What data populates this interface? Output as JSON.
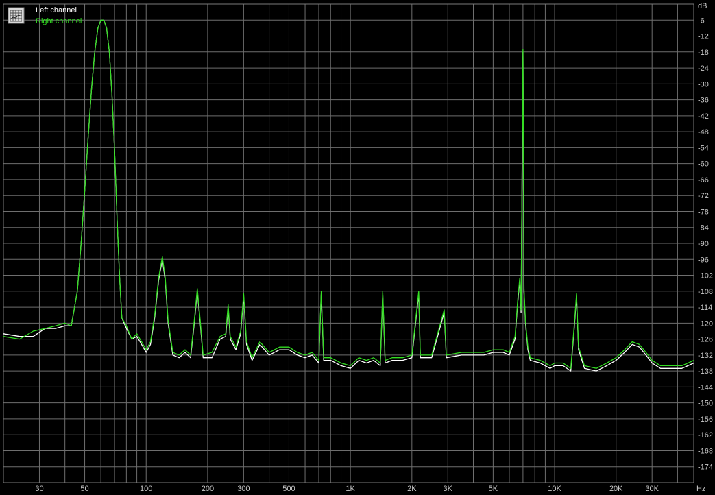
{
  "chart_data": {
    "type": "line",
    "x_scale": "log",
    "xlim": [
      20,
      48000
    ],
    "ylim": [
      -180,
      0
    ],
    "grid": true,
    "legend_position": "top-left",
    "y_unit": "dB",
    "x_unit": "Hz",
    "y_ticks": [
      -6,
      -12,
      -18,
      -24,
      -30,
      -36,
      -42,
      -48,
      -54,
      -60,
      -66,
      -72,
      -78,
      -84,
      -90,
      -96,
      -102,
      -108,
      -114,
      -120,
      -126,
      -132,
      -138,
      -144,
      -150,
      -156,
      -162,
      -168,
      -174
    ],
    "x_ticks": [
      {
        "value": 30,
        "label": "30"
      },
      {
        "value": 50,
        "label": "50"
      },
      {
        "value": 100,
        "label": "100"
      },
      {
        "value": 200,
        "label": "200"
      },
      {
        "value": 300,
        "label": "300"
      },
      {
        "value": 500,
        "label": "500"
      },
      {
        "value": 1000,
        "label": "1K"
      },
      {
        "value": 2000,
        "label": "2K"
      },
      {
        "value": 3000,
        "label": "3K"
      },
      {
        "value": 5000,
        "label": "5K"
      },
      {
        "value": 10000,
        "label": "10K"
      },
      {
        "value": 20000,
        "label": "20K"
      },
      {
        "value": 30000,
        "label": "30K"
      }
    ],
    "series": [
      {
        "name": "Left channel",
        "color": "#ffffff",
        "points": [
          [
            20,
            -124
          ],
          [
            24,
            -125
          ],
          [
            28,
            -125
          ],
          [
            32,
            -122
          ],
          [
            36,
            -122
          ],
          [
            40,
            -121
          ],
          [
            43,
            -121
          ],
          [
            46,
            -108
          ],
          [
            48,
            -90
          ],
          [
            50,
            -70
          ],
          [
            52,
            -50
          ],
          [
            54,
            -32
          ],
          [
            56,
            -18
          ],
          [
            58,
            -9
          ],
          [
            60,
            -6
          ],
          [
            62,
            -6
          ],
          [
            64,
            -9
          ],
          [
            66,
            -18
          ],
          [
            68,
            -34
          ],
          [
            70,
            -55
          ],
          [
            72,
            -80
          ],
          [
            74,
            -102
          ],
          [
            76,
            -118
          ],
          [
            80,
            -122
          ],
          [
            85,
            -126
          ],
          [
            90,
            -125
          ],
          [
            95,
            -128
          ],
          [
            100,
            -131
          ],
          [
            105,
            -128
          ],
          [
            110,
            -118
          ],
          [
            115,
            -104
          ],
          [
            120,
            -96
          ],
          [
            124,
            -104
          ],
          [
            128,
            -120
          ],
          [
            135,
            -132
          ],
          [
            145,
            -133
          ],
          [
            155,
            -131
          ],
          [
            165,
            -133
          ],
          [
            172,
            -120
          ],
          [
            178,
            -108
          ],
          [
            184,
            -120
          ],
          [
            190,
            -133
          ],
          [
            210,
            -133
          ],
          [
            230,
            -126
          ],
          [
            245,
            -125
          ],
          [
            252,
            -114
          ],
          [
            258,
            -126
          ],
          [
            275,
            -130
          ],
          [
            290,
            -124
          ],
          [
            300,
            -110
          ],
          [
            310,
            -128
          ],
          [
            330,
            -134
          ],
          [
            360,
            -128
          ],
          [
            400,
            -132
          ],
          [
            450,
            -130
          ],
          [
            500,
            -130
          ],
          [
            550,
            -132
          ],
          [
            600,
            -133
          ],
          [
            650,
            -132
          ],
          [
            700,
            -135
          ],
          [
            720,
            -109
          ],
          [
            740,
            -134
          ],
          [
            800,
            -134
          ],
          [
            900,
            -136
          ],
          [
            1000,
            -137
          ],
          [
            1100,
            -134
          ],
          [
            1200,
            -135
          ],
          [
            1300,
            -134
          ],
          [
            1400,
            -136
          ],
          [
            1440,
            -109
          ],
          [
            1480,
            -135
          ],
          [
            1600,
            -134
          ],
          [
            1800,
            -134
          ],
          [
            2000,
            -133
          ],
          [
            2160,
            -109
          ],
          [
            2200,
            -133
          ],
          [
            2500,
            -133
          ],
          [
            2880,
            -116
          ],
          [
            2950,
            -133
          ],
          [
            3500,
            -132
          ],
          [
            4000,
            -132
          ],
          [
            4500,
            -132
          ],
          [
            5000,
            -131
          ],
          [
            5600,
            -131
          ],
          [
            6000,
            -132
          ],
          [
            6400,
            -126
          ],
          [
            6600,
            -112
          ],
          [
            6750,
            -104
          ],
          [
            6850,
            -116
          ],
          [
            7000,
            -18
          ],
          [
            7080,
            -108
          ],
          [
            7200,
            -120
          ],
          [
            7400,
            -130
          ],
          [
            7600,
            -134
          ],
          [
            8500,
            -135
          ],
          [
            9500,
            -137
          ],
          [
            10000,
            -136
          ],
          [
            11000,
            -136
          ],
          [
            12000,
            -138
          ],
          [
            12500,
            -121
          ],
          [
            12800,
            -110
          ],
          [
            13100,
            -130
          ],
          [
            14000,
            -137
          ],
          [
            16000,
            -138
          ],
          [
            18000,
            -136
          ],
          [
            20000,
            -134
          ],
          [
            22000,
            -131
          ],
          [
            24000,
            -128
          ],
          [
            26000,
            -129
          ],
          [
            28000,
            -132
          ],
          [
            30000,
            -135
          ],
          [
            33000,
            -137
          ],
          [
            38000,
            -137
          ],
          [
            42000,
            -137
          ],
          [
            45000,
            -136
          ],
          [
            48000,
            -135
          ]
        ]
      },
      {
        "name": "Right channel",
        "color": "#33dd22",
        "points": [
          [
            20,
            -125
          ],
          [
            24,
            -126
          ],
          [
            28,
            -123
          ],
          [
            32,
            -122
          ],
          [
            36,
            -121
          ],
          [
            40,
            -120
          ],
          [
            43,
            -121
          ],
          [
            46,
            -108
          ],
          [
            48,
            -90
          ],
          [
            50,
            -70
          ],
          [
            52,
            -50
          ],
          [
            54,
            -32
          ],
          [
            56,
            -18
          ],
          [
            58,
            -9
          ],
          [
            60,
            -6
          ],
          [
            62,
            -6
          ],
          [
            64,
            -9
          ],
          [
            66,
            -18
          ],
          [
            68,
            -34
          ],
          [
            70,
            -55
          ],
          [
            72,
            -80
          ],
          [
            74,
            -102
          ],
          [
            76,
            -118
          ],
          [
            80,
            -121
          ],
          [
            85,
            -126
          ],
          [
            90,
            -124
          ],
          [
            95,
            -127
          ],
          [
            100,
            -130
          ],
          [
            105,
            -127
          ],
          [
            110,
            -117
          ],
          [
            115,
            -103
          ],
          [
            120,
            -95
          ],
          [
            124,
            -103
          ],
          [
            128,
            -119
          ],
          [
            135,
            -131
          ],
          [
            145,
            -132
          ],
          [
            155,
            -130
          ],
          [
            165,
            -132
          ],
          [
            172,
            -119
          ],
          [
            178,
            -107
          ],
          [
            184,
            -119
          ],
          [
            190,
            -132
          ],
          [
            210,
            -131
          ],
          [
            230,
            -125
          ],
          [
            245,
            -124
          ],
          [
            252,
            -113
          ],
          [
            258,
            -125
          ],
          [
            275,
            -129
          ],
          [
            290,
            -123
          ],
          [
            300,
            -109
          ],
          [
            310,
            -127
          ],
          [
            330,
            -133
          ],
          [
            360,
            -127
          ],
          [
            400,
            -131
          ],
          [
            450,
            -129
          ],
          [
            500,
            -129
          ],
          [
            550,
            -131
          ],
          [
            600,
            -132
          ],
          [
            650,
            -131
          ],
          [
            700,
            -134
          ],
          [
            720,
            -108
          ],
          [
            740,
            -133
          ],
          [
            800,
            -133
          ],
          [
            900,
            -135
          ],
          [
            1000,
            -136
          ],
          [
            1100,
            -133
          ],
          [
            1200,
            -134
          ],
          [
            1300,
            -133
          ],
          [
            1400,
            -135
          ],
          [
            1440,
            -108
          ],
          [
            1480,
            -134
          ],
          [
            1600,
            -133
          ],
          [
            1800,
            -133
          ],
          [
            2000,
            -132
          ],
          [
            2160,
            -108
          ],
          [
            2200,
            -132
          ],
          [
            2500,
            -132
          ],
          [
            2880,
            -115
          ],
          [
            2950,
            -132
          ],
          [
            3500,
            -131
          ],
          [
            4000,
            -131
          ],
          [
            4500,
            -131
          ],
          [
            5000,
            -130
          ],
          [
            5600,
            -130
          ],
          [
            6000,
            -131
          ],
          [
            6400,
            -125
          ],
          [
            6600,
            -111
          ],
          [
            6750,
            -103
          ],
          [
            6850,
            -115
          ],
          [
            7000,
            -17
          ],
          [
            7080,
            -107
          ],
          [
            7200,
            -119
          ],
          [
            7400,
            -129
          ],
          [
            7600,
            -133
          ],
          [
            8500,
            -134
          ],
          [
            9500,
            -136
          ],
          [
            10000,
            -135
          ],
          [
            11000,
            -135
          ],
          [
            12000,
            -137
          ],
          [
            12500,
            -120
          ],
          [
            12800,
            -109
          ],
          [
            13100,
            -129
          ],
          [
            14000,
            -136
          ],
          [
            16000,
            -137
          ],
          [
            18000,
            -135
          ],
          [
            20000,
            -133
          ],
          [
            22000,
            -130
          ],
          [
            24000,
            -127
          ],
          [
            26000,
            -128
          ],
          [
            28000,
            -131
          ],
          [
            30000,
            -134
          ],
          [
            33000,
            -136
          ],
          [
            38000,
            -136
          ],
          [
            42000,
            -136
          ],
          [
            45000,
            -135
          ],
          [
            48000,
            -134
          ]
        ]
      }
    ]
  }
}
